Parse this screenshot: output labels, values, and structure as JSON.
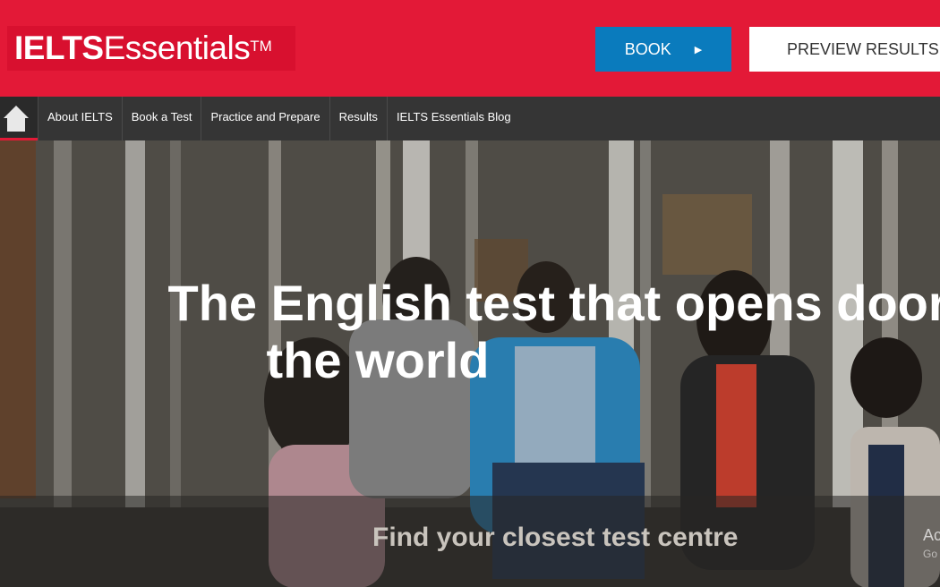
{
  "header": {
    "logo_bold": "IELTS",
    "logo_light": "Essentials",
    "logo_tm": "TM",
    "book_label": "BOOK",
    "book_arrow": "▶",
    "preview_label": "PREVIEW RESULTS"
  },
  "nav": {
    "home_icon": "home-icon",
    "items": [
      {
        "label": "About IELTS"
      },
      {
        "label": "Book a Test"
      },
      {
        "label": "Practice and Prepare"
      },
      {
        "label": "Results"
      },
      {
        "label": "IELTS Essentials Blog"
      }
    ]
  },
  "hero": {
    "title_line1": "The English test that opens doors a",
    "title_line2": "the world",
    "find_label": "Find your closest test centre",
    "watermark_1": "Ac",
    "watermark_2": "Go"
  },
  "colors": {
    "brand_red": "#e31937",
    "book_blue": "#0a7bbd",
    "nav_dark": "#353535"
  }
}
